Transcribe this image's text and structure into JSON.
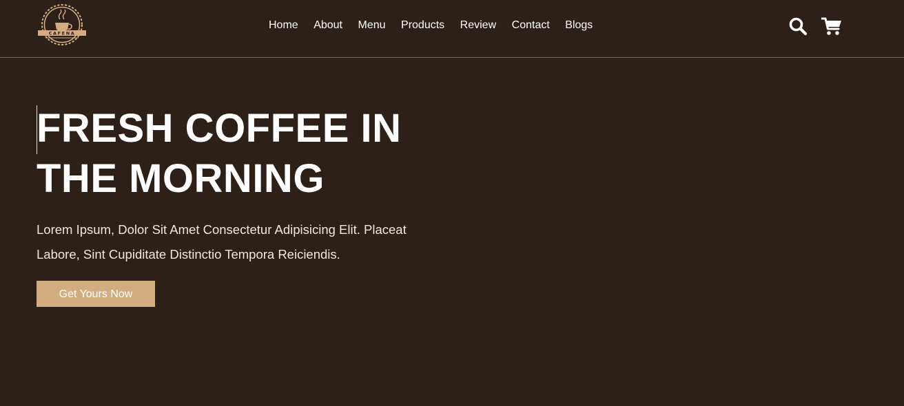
{
  "brand": {
    "logo_text": "CAFENA"
  },
  "nav": {
    "items": [
      "Home",
      "About",
      "Menu",
      "Products",
      "Review",
      "Contact",
      "Blogs"
    ]
  },
  "header_icons": {
    "search": "search-icon",
    "cart": "cart-icon"
  },
  "hero": {
    "title_line1": "FRESH COFFEE IN",
    "title_line2": "THE MORNING",
    "description_line1": "Lorem Ipsum, Dolor Sit Amet Consectetur Adipisicing Elit. Placeat",
    "description_line2": "Labore, Sint Cupiditate Distinctio Tempora Reiciendis.",
    "cta_label": "Get Yours Now"
  },
  "colors": {
    "background": "#2c2019",
    "accent": "#d3ad7f",
    "text": "#ffffff"
  }
}
